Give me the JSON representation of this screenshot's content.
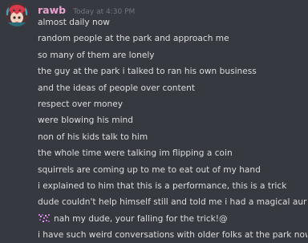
{
  "message": {
    "author": "rawb",
    "timestamp": "Today at 4:30 PM",
    "author_color": "#e8a3d0",
    "avatar_icon": "anime-character-avatar",
    "lines": [
      "almost daily now",
      "random people at the park and approach me",
      "so many of them are lonely",
      "the guy at the park i talked to ran his own business",
      "and the ideas of people over content",
      "respect over money",
      "were blowing his mind",
      "non of his kids talk to him",
      "the whole time were talking im flipping a coin",
      "squirrels are coming up to me to eat out of my hand",
      "i explained to him that this is a performance, this is a trick",
      "dude couldn't help himself still and told me i had a magical aura",
      "nah my dude, your falling for the trick!@",
      "i have such weird conversations with older folks at the park now"
    ],
    "custom_emoji": "sparkle-emoji-icon"
  },
  "colors": {
    "background": "#36393f",
    "text": "#dcddde",
    "timestamp": "#72767d"
  }
}
